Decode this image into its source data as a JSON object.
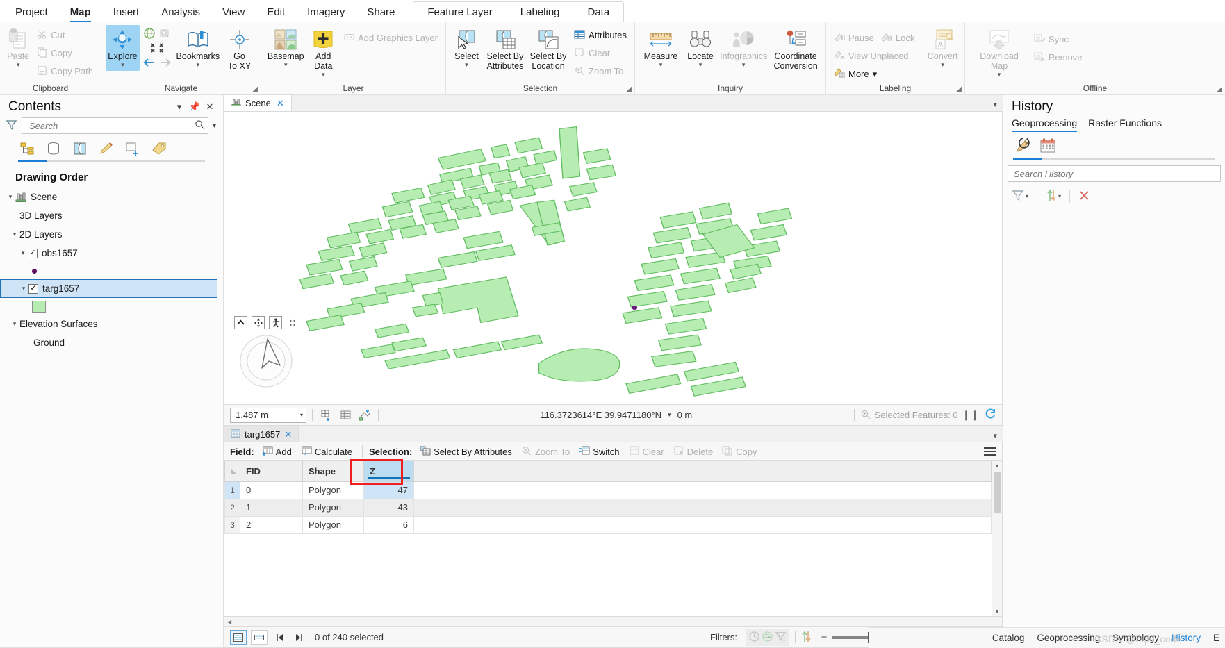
{
  "ribbon": {
    "tabs": [
      {
        "label": "Project",
        "active": false
      },
      {
        "label": "Map",
        "active": true
      },
      {
        "label": "Insert",
        "active": false
      },
      {
        "label": "Analysis",
        "active": false
      },
      {
        "label": "View",
        "active": false
      },
      {
        "label": "Edit",
        "active": false
      },
      {
        "label": "Imagery",
        "active": false
      },
      {
        "label": "Share",
        "active": false
      }
    ],
    "context_tabs": [
      {
        "label": "Feature Layer"
      },
      {
        "label": "Labeling"
      },
      {
        "label": "Data"
      }
    ],
    "groups": {
      "clipboard": {
        "label": "Clipboard",
        "paste": "Paste",
        "cut": "Cut",
        "copy": "Copy",
        "copy_path": "Copy Path"
      },
      "navigate": {
        "label": "Navigate",
        "explore": "Explore",
        "bookmarks": "Bookmarks",
        "go_to_xy": "Go\nTo XY"
      },
      "layer": {
        "label": "Layer",
        "basemap": "Basemap",
        "add_data": "Add\nData",
        "add_graphics_layer": "Add Graphics Layer"
      },
      "selection": {
        "label": "Selection",
        "select": "Select",
        "select_by_attributes": "Select By\nAttributes",
        "select_by_location": "Select By\nLocation",
        "attributes": "Attributes",
        "clear": "Clear",
        "zoom_to": "Zoom To"
      },
      "inquiry": {
        "label": "Inquiry",
        "measure": "Measure",
        "locate": "Locate",
        "infographics": "Infographics",
        "coordinate_conversion": "Coordinate\nConversion"
      },
      "labeling": {
        "label": "Labeling",
        "pause": "Pause",
        "lock": "Lock",
        "view_unplaced": "View Unplaced",
        "more": "More",
        "convert": "Convert"
      },
      "offline": {
        "label": "Offline",
        "download_map": "Download\nMap",
        "sync": "Sync",
        "remove": "Remove"
      }
    }
  },
  "contents": {
    "title": "Contents",
    "search_placeholder": "Search",
    "drawing_order": "Drawing Order",
    "tree": [
      {
        "label": "Scene",
        "level": 0,
        "arrow": true,
        "icon": "scene-icon"
      },
      {
        "label": "3D Layers",
        "level": 1,
        "arrow": false,
        "icon": "none"
      },
      {
        "label": "2D Layers",
        "level": 1,
        "arrow": true,
        "icon": "none"
      },
      {
        "label": "obs1657",
        "level": 2,
        "arrow": true,
        "checkbox": true,
        "checked": true,
        "selected": false,
        "symbol": "point",
        "symbol_color": "#5c0a5c"
      },
      {
        "label": "targ1657",
        "level": 2,
        "arrow": true,
        "checkbox": true,
        "checked": true,
        "selected": true,
        "symbol": "polygon",
        "symbol_color": "#b7ecb2"
      },
      {
        "label": "Elevation Surfaces",
        "level": 1,
        "arrow": true,
        "icon": "none"
      },
      {
        "label": "Ground",
        "level": 2,
        "arrow": false,
        "icon": "none"
      }
    ]
  },
  "mapview": {
    "tab_label": "Scene",
    "statusbar": {
      "scale": "1,487 m",
      "coordinates": "116.3723614°E 39.9471180°N",
      "elevation": "0 m",
      "selected_features": "Selected Features: 0"
    }
  },
  "attribute_table": {
    "tab_label": "targ1657",
    "toolbar": {
      "field_label": "Field:",
      "add": "Add",
      "calculate": "Calculate",
      "selection_label": "Selection:",
      "select_by_attributes": "Select By Attributes",
      "zoom_to": "Zoom To",
      "switch": "Switch",
      "clear": "Clear",
      "delete": "Delete",
      "copy": "Copy"
    },
    "columns": [
      "FID",
      "Shape",
      "Z"
    ],
    "highlighted_column": "Z",
    "rows": [
      {
        "n": "1",
        "FID": "0",
        "Shape": "Polygon",
        "Z": "47"
      },
      {
        "n": "2",
        "FID": "1",
        "Shape": "Polygon",
        "Z": "43"
      },
      {
        "n": "3",
        "FID": "2",
        "Shape": "Polygon",
        "Z": "6"
      }
    ],
    "statusbar": {
      "selection_count": "0 of 240 selected",
      "filters_label": "Filters:",
      "zoom_level": "90%"
    }
  },
  "history": {
    "title": "History",
    "tabs": [
      {
        "label": "Geoprocessing",
        "active": true
      },
      {
        "label": "Raster Functions",
        "active": false
      }
    ],
    "search_placeholder": "Search History"
  },
  "bottom_tabs": [
    {
      "label": "Catalog",
      "active": false
    },
    {
      "label": "Geoprocessing",
      "active": false
    },
    {
      "label": "Symbology",
      "active": false
    },
    {
      "label": "History",
      "active": true
    },
    {
      "label": "E",
      "active": false
    }
  ],
  "watermark": "CSDN @hqlv_code",
  "colors": {
    "accent": "#1c7fd6",
    "selection_highlight": "#cfe4f7",
    "polygon_fill": "#b7ecb2",
    "polygon_stroke": "#5cba5c",
    "marker_red": "#ef1f1f",
    "point_purple": "#5c0a5c"
  }
}
